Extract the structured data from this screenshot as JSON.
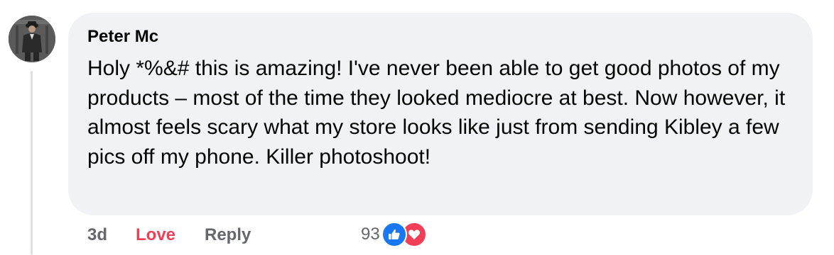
{
  "comment": {
    "author": "Peter Mc",
    "text": "Holy *%&# this is amazing! I've never been able to get good photos of my products – most of the time they looked mediocre at best. Now however, it almost feels scary what my store looks like just from sending Kibley a few pics off my phone. Killer photoshoot!",
    "avatar_icon": "person-avatar",
    "bubble_color": "#f0f2f5"
  },
  "actions": {
    "time": "3d",
    "love_label": "Love",
    "reply_label": "Reply"
  },
  "reactions": {
    "count": "93",
    "icons": [
      "like-icon",
      "love-icon"
    ],
    "like_color": "#1877f2",
    "love_color": "#f33e58"
  }
}
